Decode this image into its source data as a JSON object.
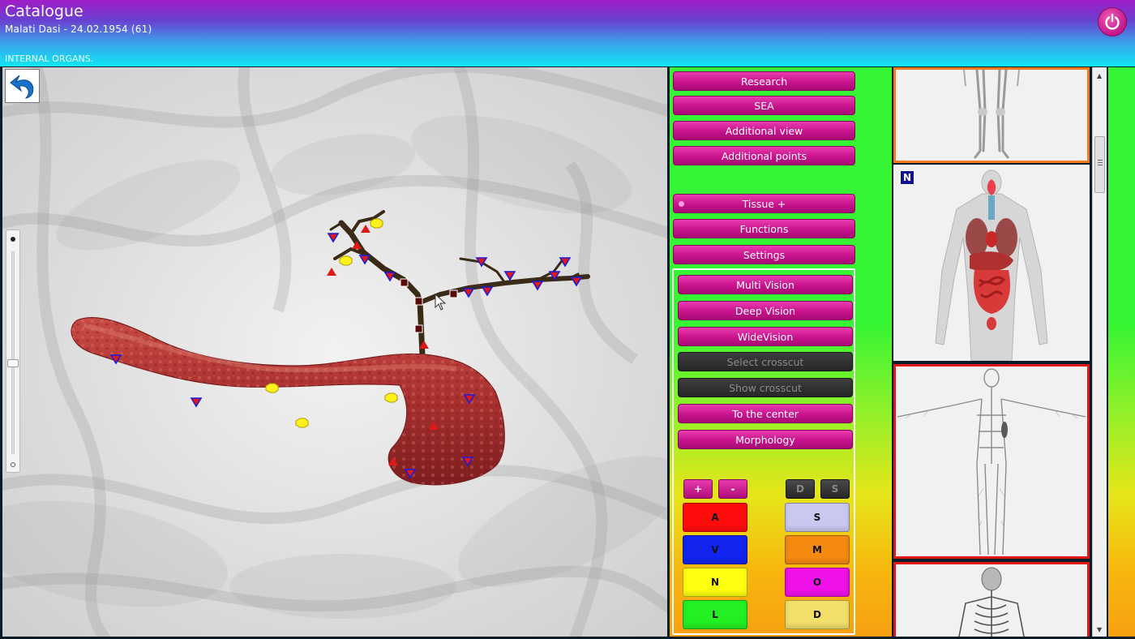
{
  "header": {
    "title": "Catalogue",
    "patient": "Malati  Dasi  -  24.02.1954 (61)",
    "section": "INTERNAL ORGANS."
  },
  "icons": {
    "power": "power-icon",
    "undo": "undo-arrow-icon"
  },
  "colors": {
    "accent_pink": "#c8138d",
    "panel_green": "#35f534",
    "panel_orange": "#f7a010",
    "header_purple": "#a11cc6",
    "header_cyan": "#10e8f2",
    "thumb_selected": "#f07a1e",
    "thumb_highlight": "#e01818"
  },
  "menu": {
    "research": "Research",
    "sea": "SEA",
    "additional_view": "Additional view",
    "additional_points": "Additional points",
    "tissue": "Tissue +",
    "functions": "Functions",
    "settings": "Settings"
  },
  "submenu": {
    "multi_vision": "Multi Vision",
    "deep_vision": "Deep Vision",
    "wide_vision": "WideVision",
    "select_crosscut": "Select crosscut",
    "show_crosscut": "Show crosscut",
    "to_center": "To the center",
    "morphology": "Morphology"
  },
  "controls": {
    "plus": "+",
    "minus": "-",
    "d_small": "D",
    "s_small": "S"
  },
  "color_buttons": {
    "a": {
      "label": "A",
      "color": "#ff0d0d"
    },
    "v": {
      "label": "V",
      "color": "#1224f0"
    },
    "n": {
      "label": "N",
      "color": "#ffff10"
    },
    "l": {
      "label": "L",
      "color": "#22f022"
    },
    "s": {
      "label": "S",
      "color": "#c8c8f0"
    },
    "m": {
      "label": "M",
      "color": "#f48a10"
    },
    "o": {
      "label": "O",
      "color": "#f010e8"
    },
    "d": {
      "label": "D",
      "color": "#f2e06a"
    }
  },
  "thumbnails": {
    "badge": "N",
    "items": [
      {
        "name": "legs-skeleton",
        "border": "#f07a1e"
      },
      {
        "name": "internal-organs",
        "border": "none"
      },
      {
        "name": "nervous-system",
        "border": "#e01818"
      },
      {
        "name": "upper-skeleton",
        "border": "#e01818"
      }
    ]
  },
  "zoom": {
    "level": 0.55
  }
}
